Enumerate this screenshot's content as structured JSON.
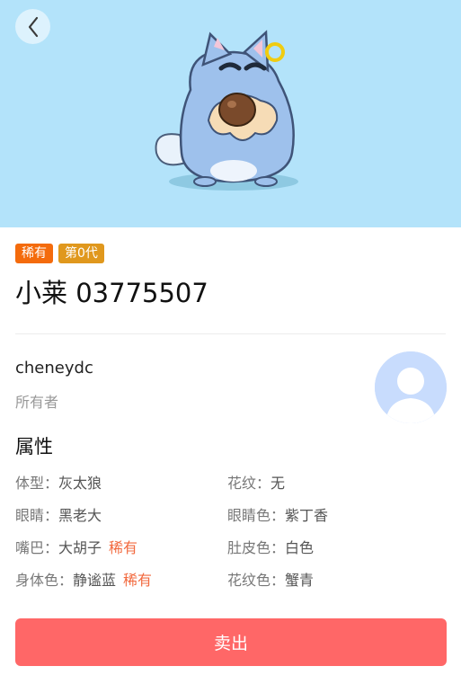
{
  "nav": {
    "back_icon": "chevron-left-icon"
  },
  "hero": {
    "background": "#b3e3fa"
  },
  "pet": {
    "tags": [
      {
        "label": "稀有",
        "color": "#f46b0c"
      },
      {
        "label": "第0代",
        "color": "#e0981d"
      }
    ],
    "title": "小莱 03775507"
  },
  "owner": {
    "name": "cheneydc",
    "caption": "所有者",
    "avatar_icon": "user-avatar-icon"
  },
  "attributes": {
    "heading": "属性",
    "items": [
      {
        "label": "体型：",
        "value": "灰太狼",
        "rare": ""
      },
      {
        "label": "花纹：",
        "value": "无",
        "rare": ""
      },
      {
        "label": "眼睛：",
        "value": "黑老大",
        "rare": ""
      },
      {
        "label": "眼睛色：",
        "value": "紫丁香",
        "rare": ""
      },
      {
        "label": "嘴巴：",
        "value": "大胡子",
        "rare": "稀有"
      },
      {
        "label": "肚皮色：",
        "value": "白色",
        "rare": ""
      },
      {
        "label": "身体色：",
        "value": "静谧蓝",
        "rare": "稀有"
      },
      {
        "label": "花纹色：",
        "value": "蟹青",
        "rare": ""
      }
    ]
  },
  "actions": {
    "sell_label": "卖出",
    "sell_color": "#ff6767"
  }
}
